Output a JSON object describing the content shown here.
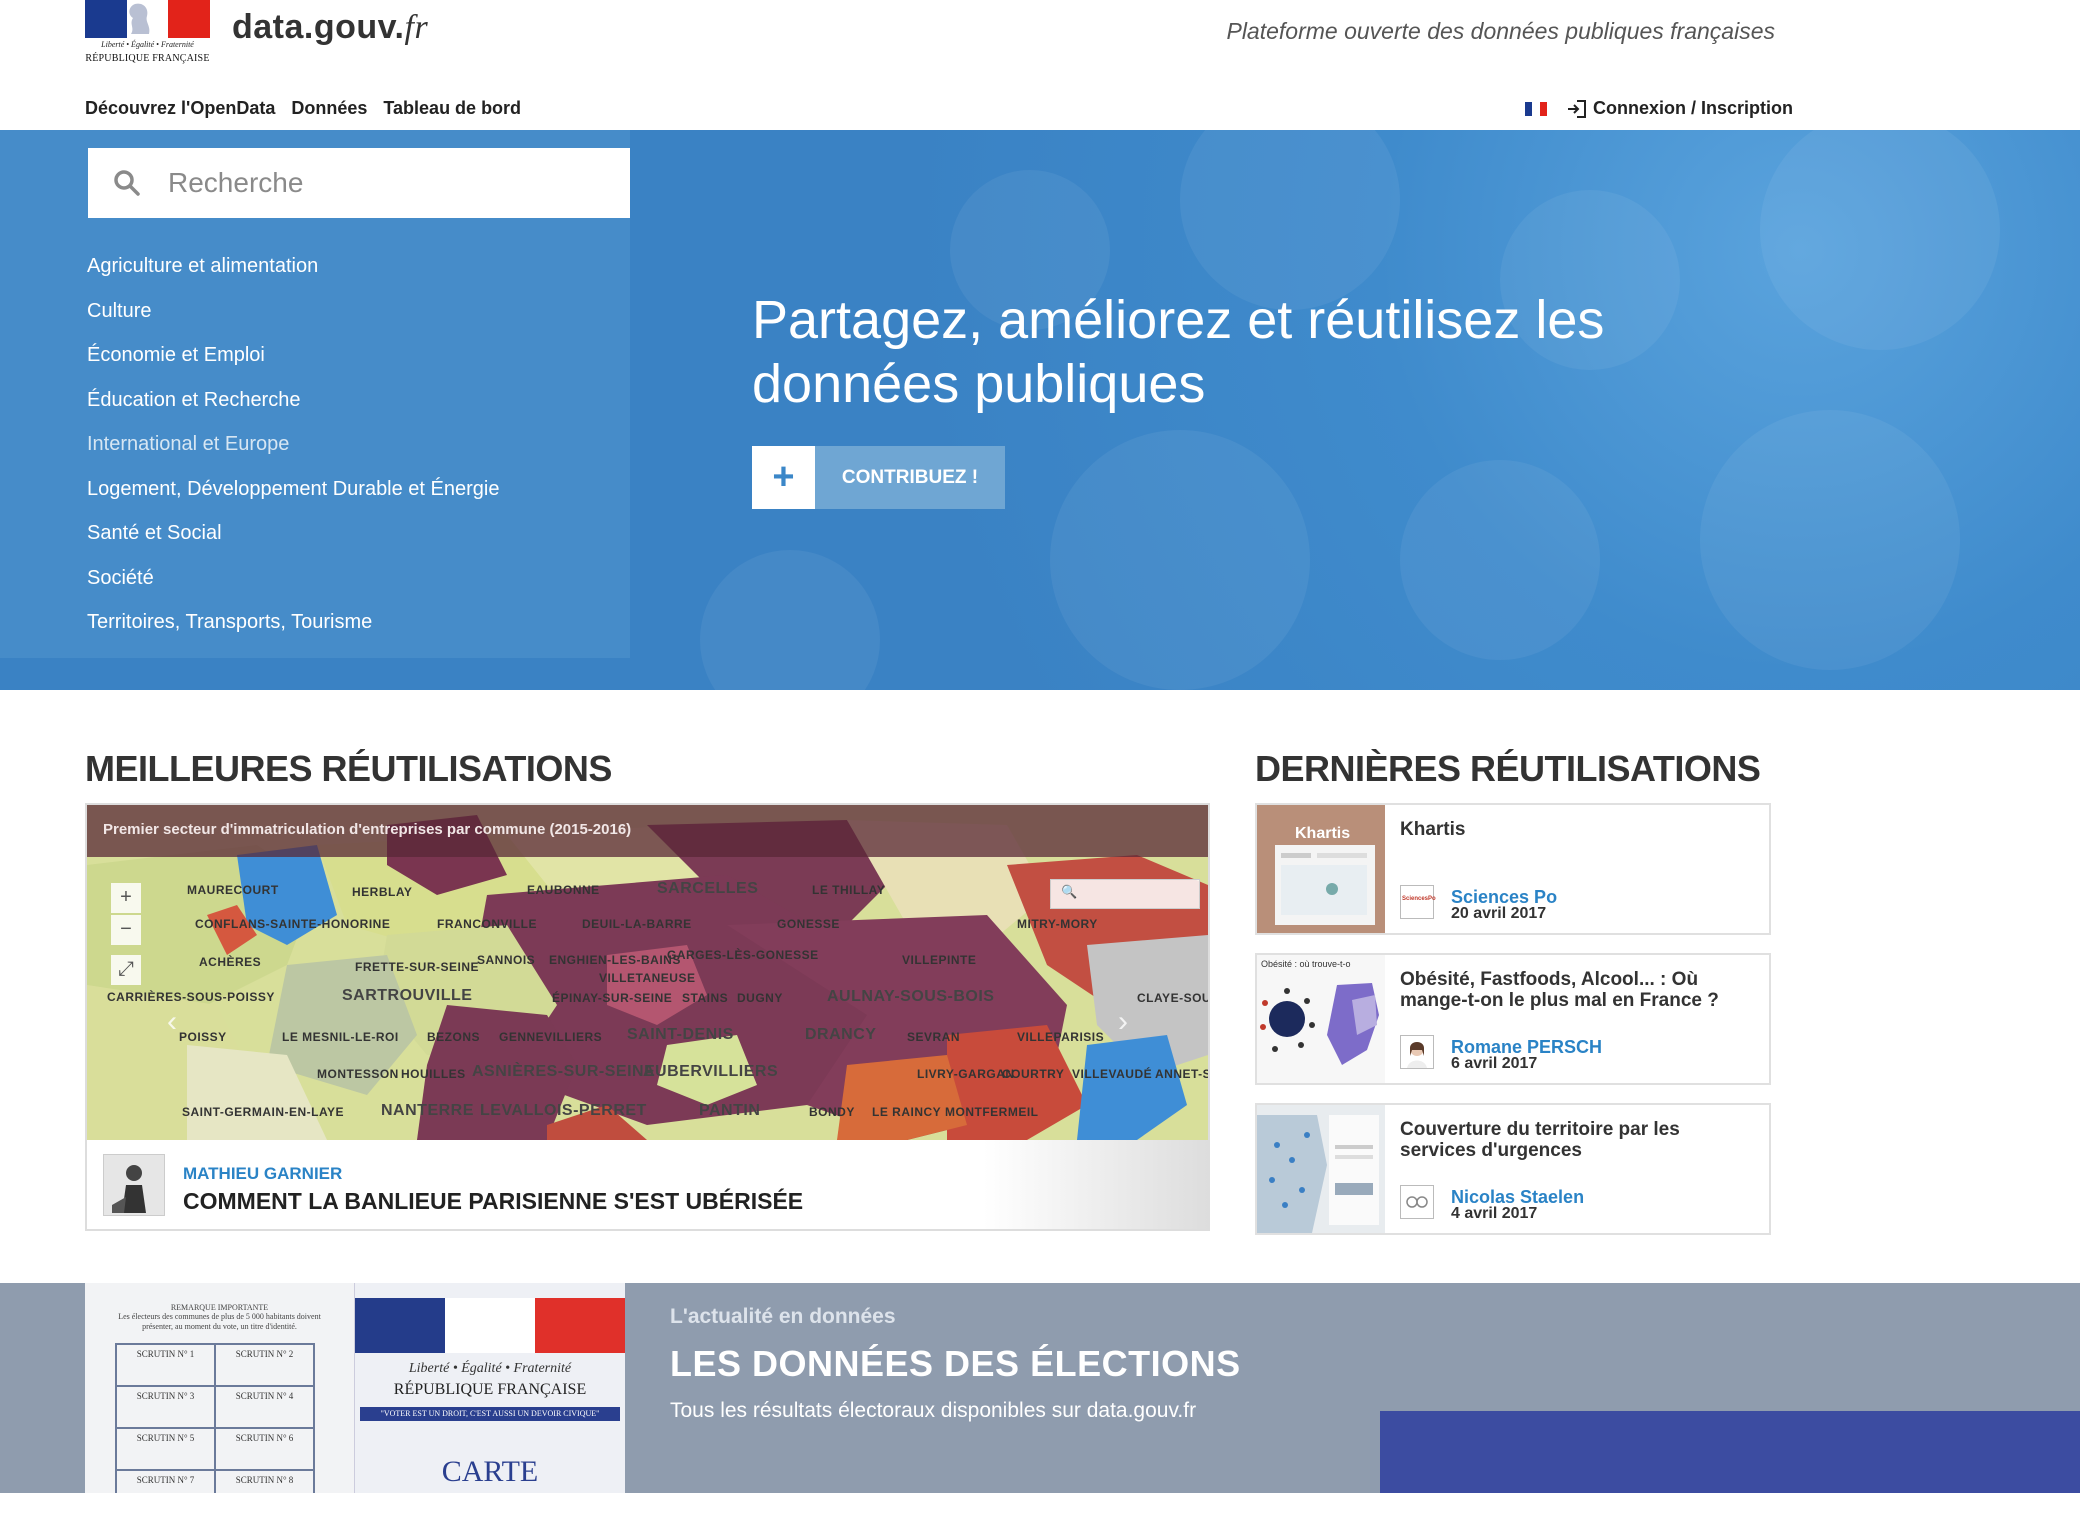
{
  "header": {
    "logo_motto": "Liberté • Égalité • Fraternité",
    "logo_rf": "RÉPUBLIQUE FRANÇAISE",
    "brand_main": "data.gouv.",
    "brand_ext": "fr",
    "tagline": "Plateforme ouverte des données publiques françaises",
    "nav": [
      "Découvrez l'OpenData",
      "Données",
      "Tableau de bord"
    ],
    "login_label": "Connexion / Inscription"
  },
  "hero": {
    "search_placeholder": "Recherche",
    "topics": [
      "Agriculture et alimentation",
      "Culture",
      "Économie et Emploi",
      "Éducation et Recherche",
      "International et Europe",
      "Logement, Développement Durable et Énergie",
      "Santé et Social",
      "Société",
      "Territoires, Transports, Tourisme"
    ],
    "title": "Partagez, améliorez et réutilisez les données publiques",
    "cta_plus": "+",
    "cta_label": "CONTRIBUEZ !"
  },
  "best": {
    "section_title": "MEILLEURES RÉUTILISATIONS",
    "map_caption": "Premier secteur d'immatriculation d'entreprises par commune (2015-2016)",
    "map_search_icon": "🔍",
    "towns": [
      "Maurecourt",
      "Herblay",
      "Eaubonne",
      "Sarcelles",
      "Le Thillay",
      "Conflans-Sainte-Honorine",
      "Franconville",
      "Deuil-la-Barre",
      "Gonesse",
      "Mitry-Mory",
      "Achères",
      "Frette-sur-Seine",
      "Sannois",
      "Enghien-les-Bains",
      "Garges-lès-Gonesse",
      "Villepinte",
      "Villetaneuse",
      "Carrières-sous-Poissy",
      "Sartrouville",
      "Épinay-sur-Seine",
      "Stains",
      "Dugny",
      "Aulnay-sous-Bois",
      "Claye-Souilly",
      "Poissy",
      "Le Mesnil-le-Roi",
      "Bezons",
      "Gennevilliers",
      "Saint-Denis",
      "Drancy",
      "Sevran",
      "Villeparisis",
      "Montesson",
      "Houilles",
      "Asnières-sur-Seine",
      "Aubervilliers",
      "Livry-Gargan",
      "Courtry",
      "Villevaudé",
      "Annet-sur",
      "Saint-Germain-en-Laye",
      "Nanterre",
      "Levallois-Perret",
      "Pantin",
      "Bondy",
      "Le Raincy",
      "Montfermeil"
    ],
    "author": "MATHIEU GARNIER",
    "reuse_title": "COMMENT LA BANLIEUE PARISIENNE S'EST UBÉRISÉE"
  },
  "last": {
    "section_title": "DERNIÈRES RÉUTILISATIONS",
    "items": [
      {
        "title": "Khartis",
        "owner": "Sciences Po",
        "date": "20 avril 2017",
        "thumb_label": "Khartis",
        "logo_text": "SciencesPo"
      },
      {
        "title": "Obésité, Fastfoods, Alcool... : Où mange-t-on le plus mal en France ?",
        "owner": "Romane PERSCH",
        "date": "6 avril 2017",
        "thumb_label": "Obésité : où trouve-t-o",
        "logo_text": ""
      },
      {
        "title": "Couverture du territoire par les services d'urgences",
        "owner": "Nicolas Staelen",
        "date": "4 avril 2017",
        "thumb_label": "",
        "logo_text": ""
      }
    ]
  },
  "news": {
    "kicker": "L'actualité en données",
    "title": "LES DONNÉES DES ÉLECTIONS",
    "desc": "Tous les résultats électoraux disponibles sur data.gouv.fr",
    "card_note_title": "REMARQUE IMPORTANTE",
    "card_note": "Les électeurs des communes de plus de 5 000 habitants doivent présenter, au moment du vote, un titre d'identité.",
    "scrutins": [
      "SCRUTIN N° 1",
      "SCRUTIN N° 2",
      "SCRUTIN N° 3",
      "SCRUTIN N° 4",
      "SCRUTIN N° 5",
      "SCRUTIN N° 6",
      "SCRUTIN N° 7",
      "SCRUTIN N° 8"
    ],
    "card_motto": "Liberté • Égalité • Fraternité",
    "card_rf": "RÉPUBLIQUE FRANÇAISE",
    "card_slogan": "\"VOTER EST UN DROIT, C'EST AUSSI UN DEVOIR CIVIQUE\"",
    "card_word": "CARTE"
  },
  "colors": {
    "accent_blue": "#3b87c8",
    "link_blue": "#2a83c6",
    "hero_blue": "#3e88c9"
  }
}
